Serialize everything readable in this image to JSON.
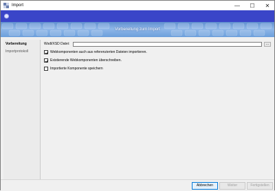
{
  "window": {
    "title": "Import",
    "minimize_glyph": "—",
    "maximize_glyph": "☐",
    "close_glyph": "✕"
  },
  "banner": {
    "title": "Vorbereitung zum Import"
  },
  "sidebar": {
    "items": [
      {
        "label": "Vorbereitung",
        "active": true
      },
      {
        "label": "Importprotokoll",
        "active": false
      }
    ]
  },
  "form": {
    "wsdl_label": "Wsdl/XSD Datei:",
    "wsdl_value": "",
    "browse_label": "...",
    "options": [
      {
        "label": "Webkomponenten auch aus referenzierten Dateien importieren.",
        "checked": true
      },
      {
        "label": "Existierende Webkomponenten überschreiben.",
        "checked": true
      },
      {
        "label": "Importierte Komponente speichern",
        "checked": false
      }
    ]
  },
  "footer": {
    "cancel_label": "Abbrechen",
    "next_label": "Weiter",
    "finish_label": "Fertigstellen"
  },
  "colors": {
    "blue_bar": "#3a45c8",
    "banner_light": "#8fb7e8",
    "banner_dark": "#5f8fcf"
  },
  "icons": [
    "app-import-icon",
    "minimize-icon",
    "maximize-icon",
    "close-icon",
    "back-circle-icon",
    "checkmark-icon"
  ]
}
